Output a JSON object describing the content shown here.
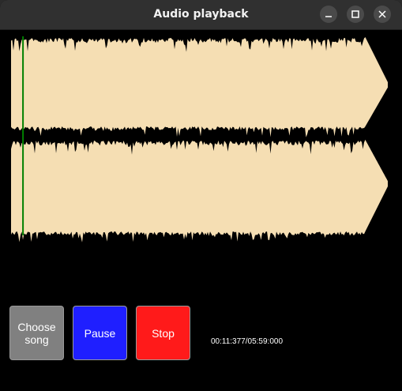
{
  "window": {
    "title": "Audio playback"
  },
  "controls": {
    "choose_label_line1": "Choose",
    "choose_label_line2": "song",
    "pause_label": "Pause",
    "stop_label": "Stop"
  },
  "playback": {
    "time_display": "00:11:377/05:59:000",
    "position_fraction": 0.0316
  },
  "waveform": {
    "fill_color": "#f5deb3",
    "cursor_color": "#008000",
    "background_color": "#000000"
  },
  "colors": {
    "choose_button": "#808080",
    "pause_button": "#1f1fff",
    "stop_button": "#ff1a1a"
  },
  "icons": [
    "minimize-icon",
    "maximize-icon",
    "close-icon"
  ]
}
